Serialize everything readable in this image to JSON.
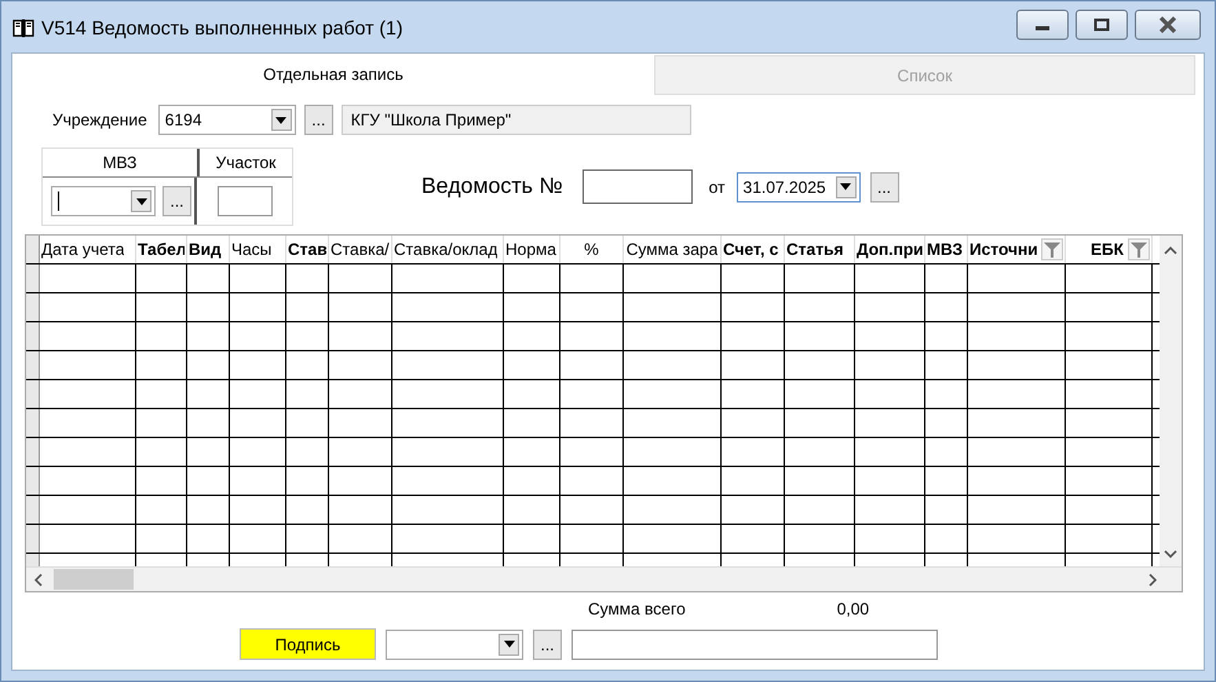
{
  "window": {
    "title": "V514 Ведомость выполненных работ (1)"
  },
  "tabs": [
    {
      "label": "Отдельная запись",
      "selected": true
    },
    {
      "label": "Список",
      "selected": false
    }
  ],
  "institution": {
    "label": "Учреждение",
    "code": "6194",
    "browse_button": "...",
    "name": "КГУ \"Школа Пример\""
  },
  "mvz_panel": {
    "mvz_header": "МВЗ",
    "site_header": "Участок",
    "browse_button": "..."
  },
  "statement": {
    "label": "Ведомость №",
    "date_label": "от",
    "date": "31.07.2025",
    "browse_button": "..."
  },
  "table": {
    "columns": [
      {
        "label": "Дата учета",
        "bold": false,
        "filter": false
      },
      {
        "label": "Табел",
        "bold": true,
        "filter": false
      },
      {
        "label": "Вид",
        "bold": true,
        "filter": false
      },
      {
        "label": "Часы",
        "bold": false,
        "filter": false
      },
      {
        "label": "Став",
        "bold": true,
        "filter": false
      },
      {
        "label": "Ставка/",
        "bold": false,
        "filter": false
      },
      {
        "label": "Ставка/оклад",
        "bold": false,
        "filter": false
      },
      {
        "label": "Норма",
        "bold": false,
        "filter": false
      },
      {
        "label": "%",
        "bold": false,
        "filter": false
      },
      {
        "label": "Сумма зара",
        "bold": false,
        "filter": false
      },
      {
        "label": "Счет, с",
        "bold": true,
        "filter": false
      },
      {
        "label": "Статья",
        "bold": true,
        "filter": false
      },
      {
        "label": "Доп.при",
        "bold": true,
        "filter": false
      },
      {
        "label": "МВЗ",
        "bold": true,
        "filter": false
      },
      {
        "label": "Источни",
        "bold": true,
        "filter": true
      },
      {
        "label": "ЕБК",
        "bold": true,
        "filter": true
      }
    ]
  },
  "total": {
    "label": "Сумма всего",
    "value": "0,00"
  },
  "sign_button": "Подпись",
  "signer": {
    "browse_button": "..."
  }
}
